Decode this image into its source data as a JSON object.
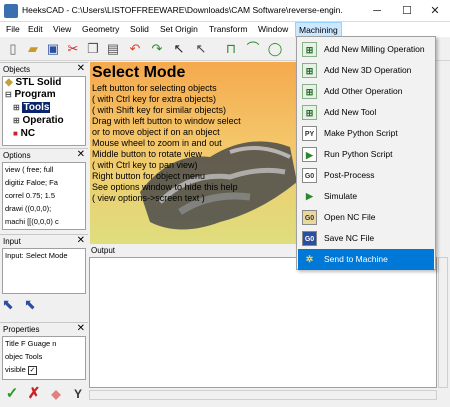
{
  "window": {
    "title": "HeeksCAD - C:\\Users\\LISTOFFREEWARE\\Downloads\\CAM Software\\reverse-engin...",
    "minimize": "─",
    "maximize": "☐",
    "close": "✕"
  },
  "menu": {
    "items": [
      "File",
      "Edit",
      "View",
      "Geometry",
      "Solid",
      "Set Origin",
      "Transform",
      "Window",
      "Machining"
    ],
    "active": "Machining"
  },
  "panels": {
    "objects": {
      "title": "Objects",
      "tree": [
        "STL Solid",
        "Program",
        "Tools",
        "Operatio",
        "NC"
      ]
    },
    "options": {
      "title": "Options",
      "rows": [
        "view ( free; full",
        "digitiz Faloe; Fa",
        "correl 0.75; 1.5",
        "drawi ((0,0,0);",
        "machi [[(0,0,0) c"
      ]
    },
    "input": {
      "title": "Input",
      "rows": [
        "Input: Select Mode"
      ]
    },
    "properties": {
      "title": "Properties",
      "rows": [
        "Title F Guage n",
        "objec Tools",
        "visible"
      ]
    }
  },
  "viewport": {
    "title": "Select Mode",
    "lines": [
      "Left button for selecting objects",
      "( with Ctrl key for extra objects)",
      "( with Shift key for similar objects)",
      "Drag with left button to window select",
      "or to move object if on an object",
      "Mouse wheel to zoom in and out",
      "Middle button to rotate view",
      "( with Ctrl key to pan view)",
      "Right button for object menu",
      "See options window to hide this help",
      "( view options->screen text )"
    ]
  },
  "output": {
    "title": "Output"
  },
  "machining_menu": {
    "items": [
      {
        "icon": "milling-op-icon",
        "glyph": "⊞",
        "label": "Add New Milling Operation"
      },
      {
        "icon": "3d-op-icon",
        "glyph": "⊞",
        "label": "Add New 3D Operation"
      },
      {
        "icon": "other-op-icon",
        "glyph": "⊞",
        "label": "Add Other Operation"
      },
      {
        "icon": "tool-icon",
        "glyph": "⊞",
        "label": "Add New Tool"
      },
      {
        "icon": "python-script-icon",
        "glyph": "PY",
        "label": "Make Python Script"
      },
      {
        "icon": "run-python-icon",
        "glyph": "▶",
        "label": "Run Python Script"
      },
      {
        "icon": "post-process-icon",
        "glyph": "G0",
        "label": "Post-Process"
      },
      {
        "icon": "simulate-icon",
        "glyph": "▶",
        "label": "Simulate"
      },
      {
        "icon": "open-nc-icon",
        "glyph": "G0",
        "label": "Open NC File"
      },
      {
        "icon": "save-nc-icon",
        "glyph": "G0",
        "label": "Save NC File"
      },
      {
        "icon": "send-machine-icon",
        "glyph": "✲",
        "label": "Send to Machine"
      }
    ],
    "selected": "Send to Machine"
  },
  "colors": {
    "menu_highlight": "#cce8ff",
    "selected_item": "#0078d7",
    "viewport_top": "#f5a94e",
    "viewport_bottom": "#dede7e"
  }
}
